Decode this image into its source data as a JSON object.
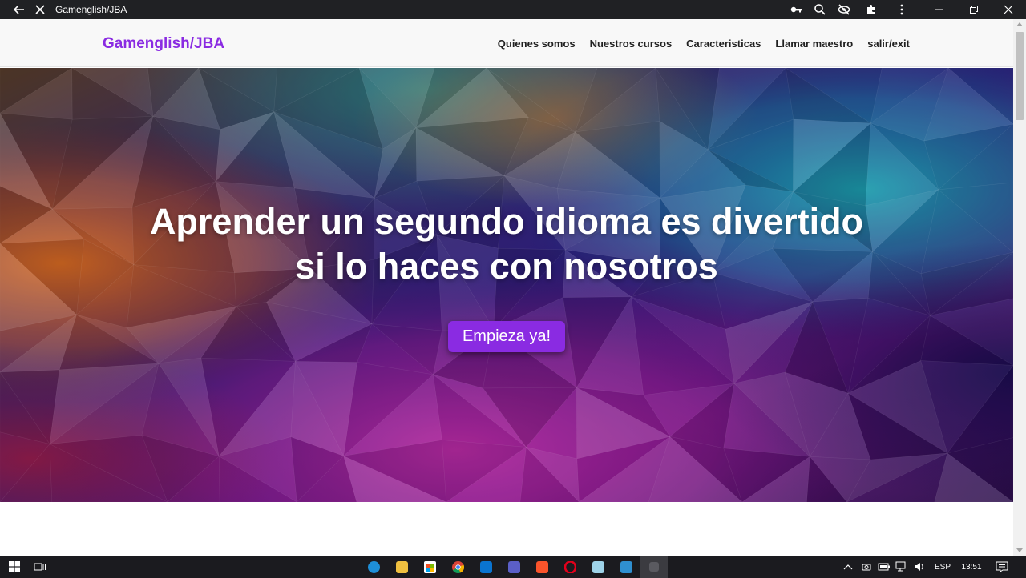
{
  "browser": {
    "tab_title": "Gamenglish/JBA",
    "icons": [
      "back-arrow-icon",
      "stop-icon",
      "key-icon",
      "zoom-icon",
      "tracking-blocked-icon",
      "extensions-icon",
      "menu-icon",
      "minimize-icon",
      "restore-icon",
      "close-icon"
    ]
  },
  "navbar": {
    "brand": "Gamenglish/JBA",
    "links": [
      "Quienes somos",
      "Nuestros cursos",
      "Caracteristicas",
      "Llamar maestro",
      "salir/exit"
    ]
  },
  "hero": {
    "title_line1": "Aprender un segundo idioma es divertido",
    "title_line2": "si lo haces con nosotros",
    "cta_label": "Empieza ya!"
  },
  "taskbar": {
    "apps": [
      "edge",
      "file-explorer",
      "store",
      "chrome",
      "mail",
      "teams",
      "brave",
      "opera",
      "notepad",
      "photos",
      "active-app"
    ],
    "language": "ESP",
    "time": "13:51"
  },
  "colors": {
    "brand": "#8a2be2",
    "cta": "#8a2be2",
    "titlebar": "#202124",
    "taskbar": "#1b1b1f"
  }
}
